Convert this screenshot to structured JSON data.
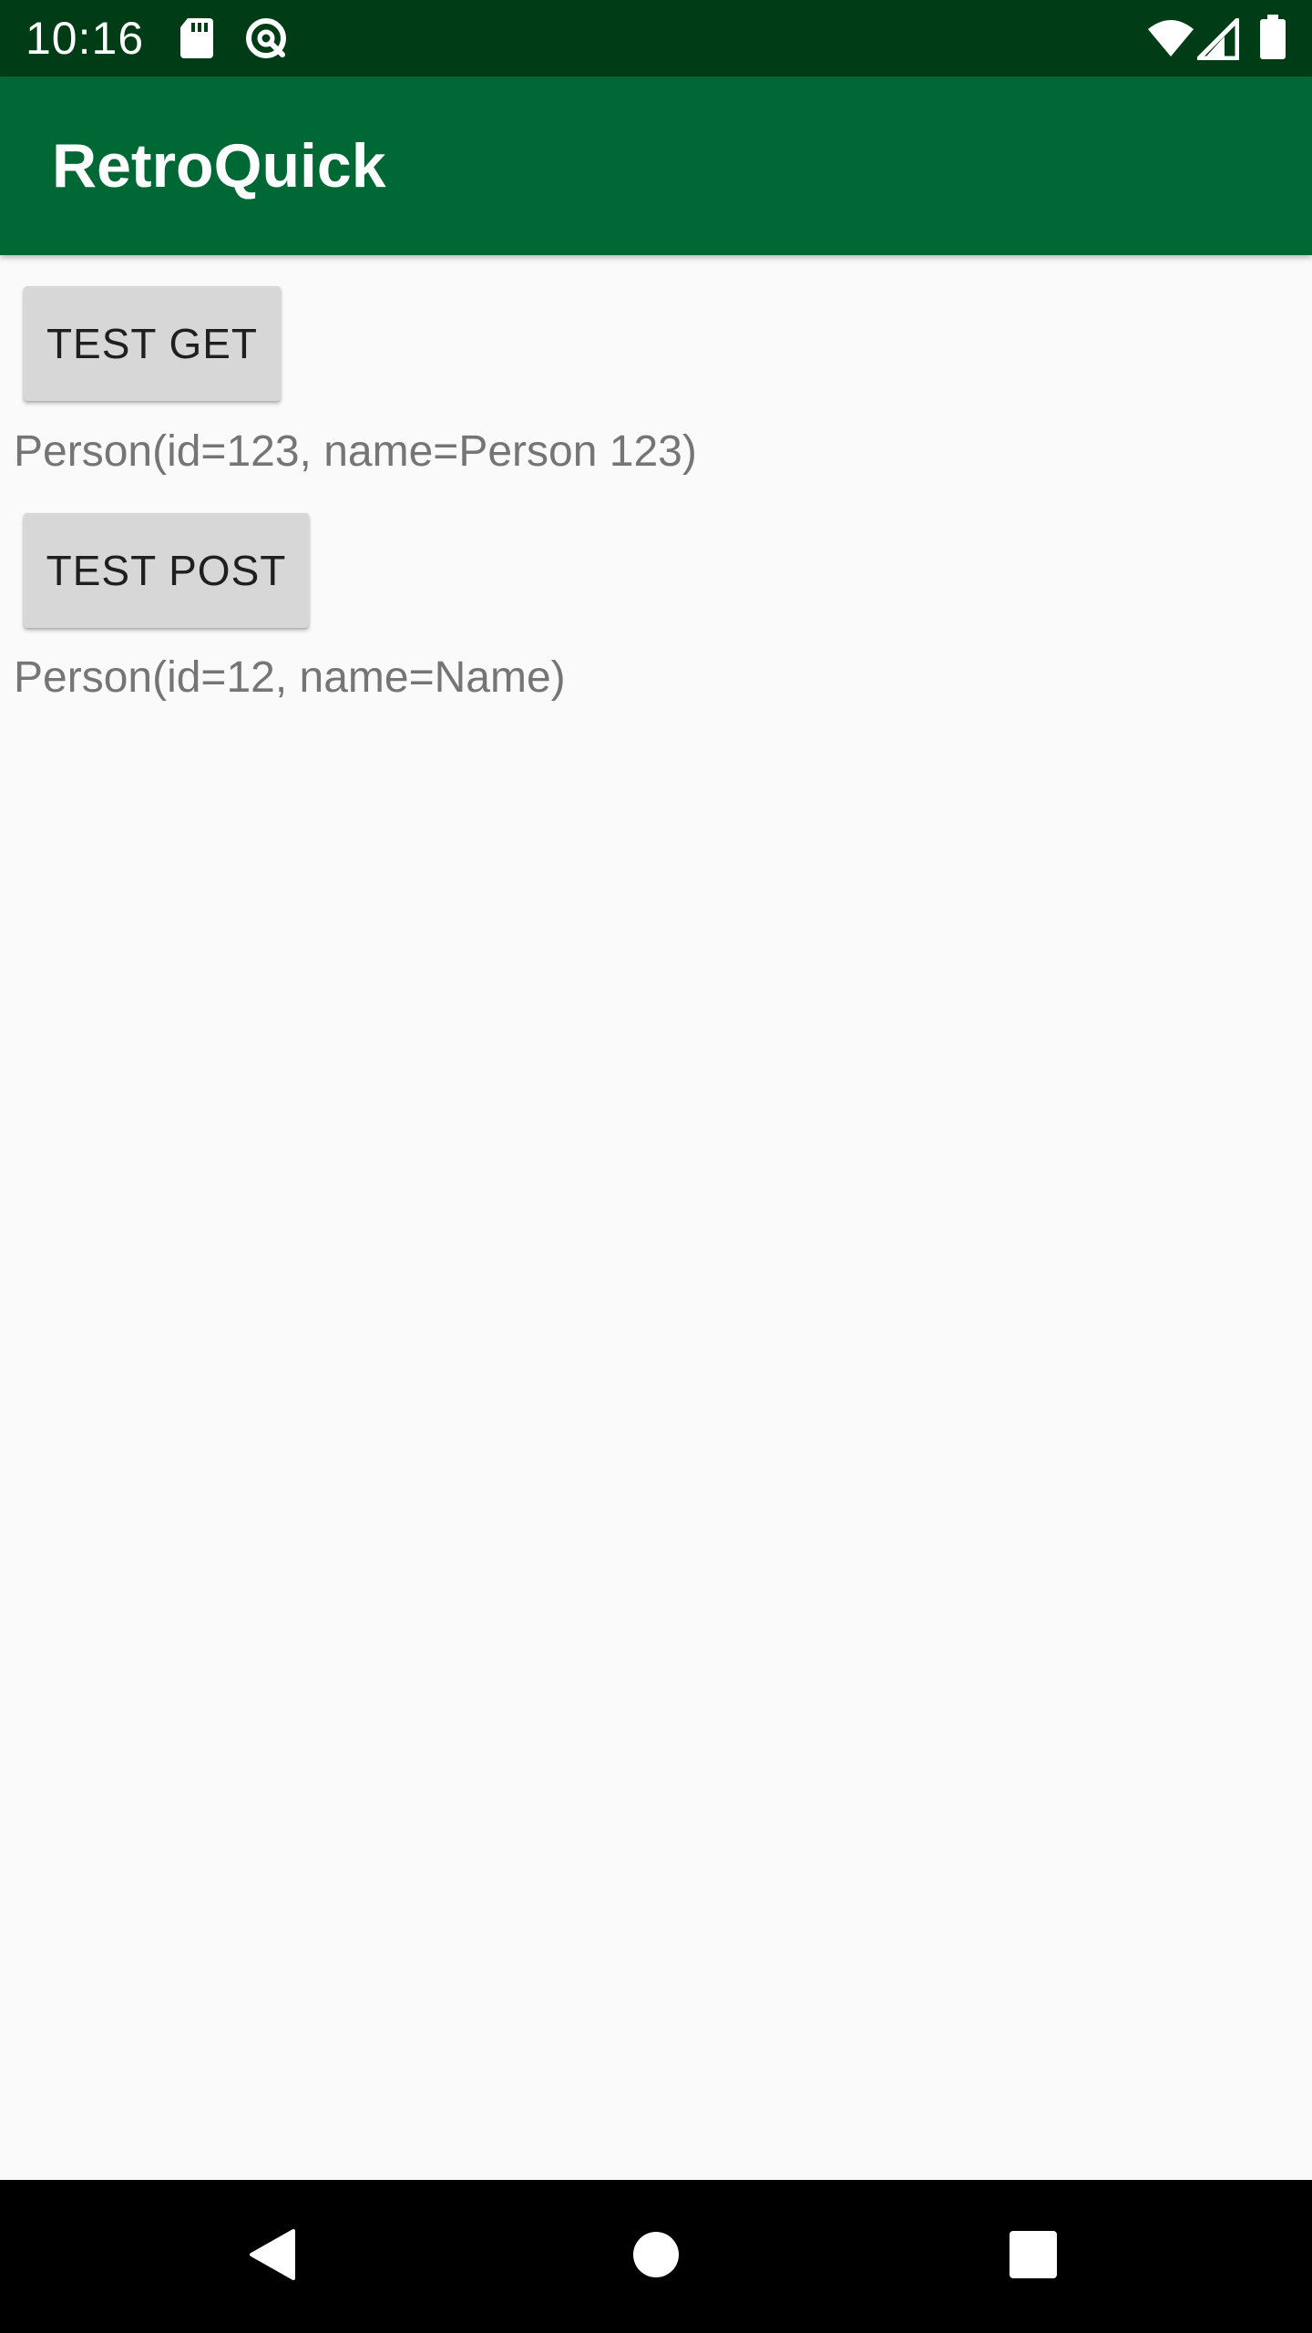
{
  "status_bar": {
    "time": "10:16",
    "icons": [
      "sd-card-icon",
      "data-saver-icon",
      "wifi-icon",
      "signal-icon",
      "battery-icon"
    ]
  },
  "app_bar": {
    "title": "RetroQuick"
  },
  "main": {
    "get_button_label": "TEST GET",
    "get_result": "Person(id=123, name=Person 123)",
    "post_button_label": "TEST POST",
    "post_result": "Person(id=12, name=Name)"
  },
  "nav_bar": {
    "icons": [
      "back-icon",
      "home-icon",
      "recents-icon"
    ]
  },
  "colors": {
    "status_bar": "#003d16",
    "app_bar": "#006835",
    "background": "#fafafa",
    "button": "#d7d7d7",
    "result_text": "#757575"
  }
}
